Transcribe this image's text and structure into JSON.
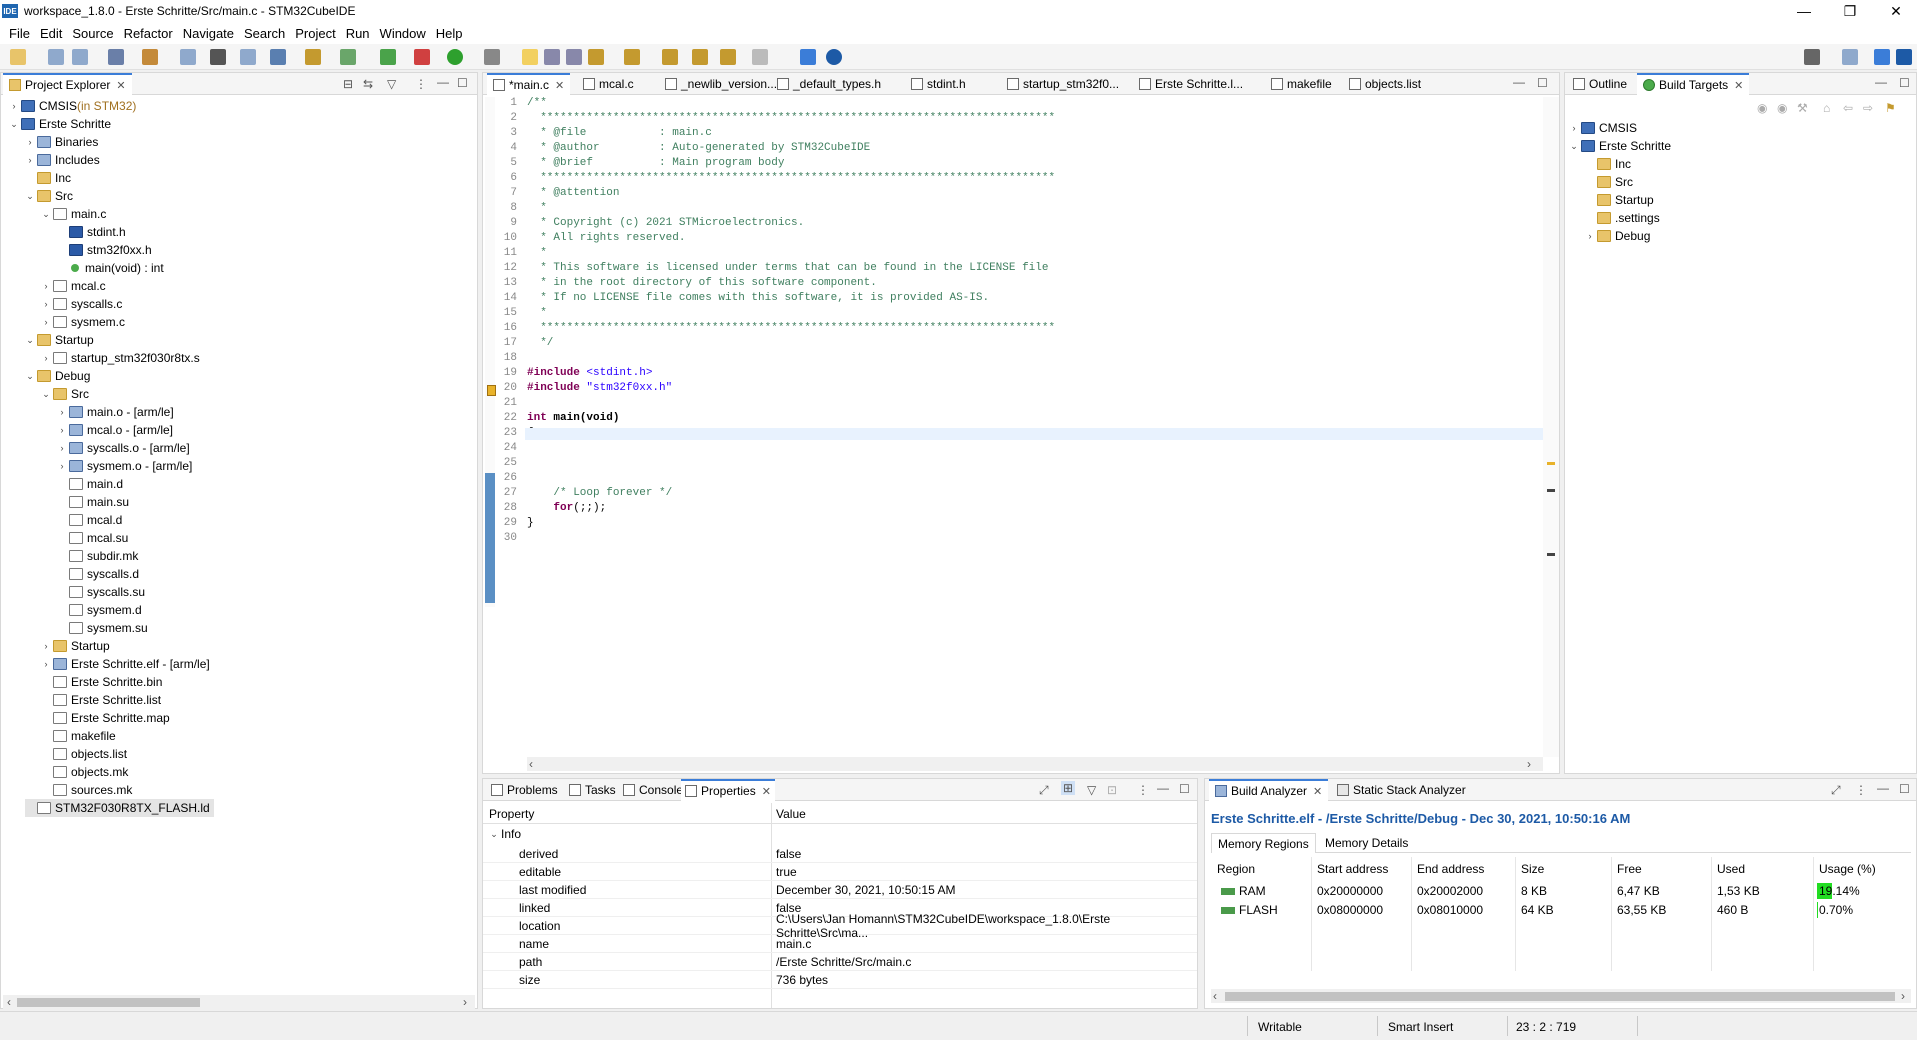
{
  "window": {
    "title": "workspace_1.8.0 - Erste Schritte/Src/main.c - STM32CubeIDE",
    "app_badge": "IDE"
  },
  "menu": [
    "File",
    "Edit",
    "Source",
    "Refactor",
    "Navigate",
    "Search",
    "Project",
    "Run",
    "Window",
    "Help"
  ],
  "project_explorer": {
    "tab_label": "Project Explorer",
    "items": [
      {
        "label": "CMSIS",
        "suffix": " (in STM32)",
        "depth": 0,
        "arrow": "›",
        "icon": "proj"
      },
      {
        "label": "Erste Schritte",
        "depth": 0,
        "arrow": "⌄",
        "icon": "proj"
      },
      {
        "label": "Binaries",
        "depth": 1,
        "arrow": "›",
        "icon": "bin"
      },
      {
        "label": "Includes",
        "depth": 1,
        "arrow": "›",
        "icon": "bin"
      },
      {
        "label": "Inc",
        "depth": 1,
        "arrow": "",
        "icon": "folder"
      },
      {
        "label": "Src",
        "depth": 1,
        "arrow": "⌄",
        "icon": "folder"
      },
      {
        "label": "main.c",
        "depth": 2,
        "arrow": "⌄",
        "icon": "file"
      },
      {
        "label": "stdint.h",
        "depth": 3,
        "arrow": "",
        "icon": "hfile"
      },
      {
        "label": "stm32f0xx.h",
        "depth": 3,
        "arrow": "",
        "icon": "hfile"
      },
      {
        "label": "main(void) : int",
        "depth": 3,
        "arrow": "",
        "icon": "green"
      },
      {
        "label": "mcal.c",
        "depth": 2,
        "arrow": "›",
        "icon": "file"
      },
      {
        "label": "syscalls.c",
        "depth": 2,
        "arrow": "›",
        "icon": "file"
      },
      {
        "label": "sysmem.c",
        "depth": 2,
        "arrow": "›",
        "icon": "file"
      },
      {
        "label": "Startup",
        "depth": 1,
        "arrow": "⌄",
        "icon": "folder"
      },
      {
        "label": "startup_stm32f030r8tx.s",
        "depth": 2,
        "arrow": "›",
        "icon": "file"
      },
      {
        "label": "Debug",
        "depth": 1,
        "arrow": "⌄",
        "icon": "folder"
      },
      {
        "label": "Src",
        "depth": 2,
        "arrow": "⌄",
        "icon": "folder"
      },
      {
        "label": "main.o - [arm/le]",
        "depth": 3,
        "arrow": "›",
        "icon": "bin"
      },
      {
        "label": "mcal.o - [arm/le]",
        "depth": 3,
        "arrow": "›",
        "icon": "bin"
      },
      {
        "label": "syscalls.o - [arm/le]",
        "depth": 3,
        "arrow": "›",
        "icon": "bin"
      },
      {
        "label": "sysmem.o - [arm/le]",
        "depth": 3,
        "arrow": "›",
        "icon": "bin"
      },
      {
        "label": "main.d",
        "depth": 3,
        "arrow": "",
        "icon": "file"
      },
      {
        "label": "main.su",
        "depth": 3,
        "arrow": "",
        "icon": "file"
      },
      {
        "label": "mcal.d",
        "depth": 3,
        "arrow": "",
        "icon": "file"
      },
      {
        "label": "mcal.su",
        "depth": 3,
        "arrow": "",
        "icon": "file"
      },
      {
        "label": "subdir.mk",
        "depth": 3,
        "arrow": "",
        "icon": "file"
      },
      {
        "label": "syscalls.d",
        "depth": 3,
        "arrow": "",
        "icon": "file"
      },
      {
        "label": "syscalls.su",
        "depth": 3,
        "arrow": "",
        "icon": "file"
      },
      {
        "label": "sysmem.d",
        "depth": 3,
        "arrow": "",
        "icon": "file"
      },
      {
        "label": "sysmem.su",
        "depth": 3,
        "arrow": "",
        "icon": "file"
      },
      {
        "label": "Startup",
        "depth": 2,
        "arrow": "›",
        "icon": "folder"
      },
      {
        "label": "Erste Schritte.elf - [arm/le]",
        "depth": 2,
        "arrow": "›",
        "icon": "bin"
      },
      {
        "label": "Erste Schritte.bin",
        "depth": 2,
        "arrow": "",
        "icon": "file"
      },
      {
        "label": "Erste Schritte.list",
        "depth": 2,
        "arrow": "",
        "icon": "file"
      },
      {
        "label": "Erste Schritte.map",
        "depth": 2,
        "arrow": "",
        "icon": "file"
      },
      {
        "label": "makefile",
        "depth": 2,
        "arrow": "",
        "icon": "file"
      },
      {
        "label": "objects.list",
        "depth": 2,
        "arrow": "",
        "icon": "file"
      },
      {
        "label": "objects.mk",
        "depth": 2,
        "arrow": "",
        "icon": "file"
      },
      {
        "label": "sources.mk",
        "depth": 2,
        "arrow": "",
        "icon": "file"
      },
      {
        "label": "STM32F030R8TX_FLASH.ld",
        "depth": 1,
        "arrow": "",
        "icon": "file",
        "selected": true
      }
    ]
  },
  "editor": {
    "tabs": [
      "*main.c",
      "mcal.c",
      "_newlib_version...",
      "_default_types.h",
      "stdint.h",
      "startup_stm32f0...",
      "Erste Schritte.l...",
      "makefile",
      "objects.list"
    ],
    "lines": [
      {
        "n": "1",
        "t": "/**",
        "c": "cmt"
      },
      {
        "n": "2",
        "t": "  ******************************************************************************",
        "c": "cmt"
      },
      {
        "n": "3",
        "t": "  * @file           : main.c",
        "c": "cmt"
      },
      {
        "n": "4",
        "t": "  * @author         : Auto-generated by STM32CubeIDE",
        "c": "cmt"
      },
      {
        "n": "5",
        "t": "  * @brief          : Main program body",
        "c": "cmt"
      },
      {
        "n": "6",
        "t": "  ******************************************************************************",
        "c": "cmt"
      },
      {
        "n": "7",
        "t": "  * @attention",
        "c": "cmt"
      },
      {
        "n": "8",
        "t": "  *",
        "c": "cmt"
      },
      {
        "n": "9",
        "t": "  * Copyright (c) 2021 STMicroelectronics.",
        "c": "cmt"
      },
      {
        "n": "10",
        "t": "  * All rights reserved.",
        "c": "cmt"
      },
      {
        "n": "11",
        "t": "  *",
        "c": "cmt"
      },
      {
        "n": "12",
        "t": "  * This software is licensed under terms that can be found in the LICENSE file",
        "c": "cmt"
      },
      {
        "n": "13",
        "t": "  * in the root directory of this software component.",
        "c": "cmt"
      },
      {
        "n": "14",
        "t": "  * If no LICENSE file comes with this software, it is provided AS-IS.",
        "c": "cmt"
      },
      {
        "n": "15",
        "t": "  *",
        "c": "cmt"
      },
      {
        "n": "16",
        "t": "  ******************************************************************************",
        "c": "cmt"
      },
      {
        "n": "17",
        "t": "  */",
        "c": "cmt"
      },
      {
        "n": "18",
        "t": "",
        "c": ""
      },
      {
        "n": "19",
        "t": "#include <stdint.h>",
        "c": "inc"
      },
      {
        "n": "20",
        "t": "#include \"stm32f0xx.h\"",
        "c": "inc"
      },
      {
        "n": "21",
        "t": "",
        "c": ""
      },
      {
        "n": "22",
        "t": "int main(void)",
        "c": "fn"
      },
      {
        "n": "23",
        "t": "{",
        "c": ""
      },
      {
        "n": "24",
        "t": "",
        "c": ""
      },
      {
        "n": "25",
        "t": "",
        "c": ""
      },
      {
        "n": "26",
        "t": "",
        "c": ""
      },
      {
        "n": "27",
        "t": "    /* Loop forever */",
        "c": "cmt"
      },
      {
        "n": "28",
        "t": "    for(;;);",
        "c": "for"
      },
      {
        "n": "29",
        "t": "}",
        "c": ""
      },
      {
        "n": "30",
        "t": "",
        "c": ""
      }
    ]
  },
  "outline": {
    "tabs": [
      "Outline",
      "Build Targets"
    ],
    "items": [
      {
        "label": "CMSIS",
        "depth": 0,
        "arrow": "›",
        "icon": "proj"
      },
      {
        "label": "Erste Schritte",
        "depth": 0,
        "arrow": "⌄",
        "icon": "proj"
      },
      {
        "label": "Inc",
        "depth": 1,
        "arrow": "",
        "icon": "folder"
      },
      {
        "label": "Src",
        "depth": 1,
        "arrow": "",
        "icon": "folder"
      },
      {
        "label": "Startup",
        "depth": 1,
        "arrow": "",
        "icon": "folder"
      },
      {
        "label": ".settings",
        "depth": 1,
        "arrow": "",
        "icon": "folder"
      },
      {
        "label": "Debug",
        "depth": 1,
        "arrow": "›",
        "icon": "folder"
      }
    ]
  },
  "bottom_left": {
    "tabs": [
      "Problems",
      "Tasks",
      "Console",
      "Properties"
    ],
    "headers": [
      "Property",
      "Value"
    ],
    "group": "Info",
    "rows": [
      [
        "derived",
        "false"
      ],
      [
        "editable",
        "true"
      ],
      [
        "last modified",
        "December 30, 2021, 10:50:15 AM"
      ],
      [
        "linked",
        "false"
      ],
      [
        "location",
        "C:\\Users\\Jan Homann\\STM32CubeIDE\\workspace_1.8.0\\Erste Schritte\\Src\\ma..."
      ],
      [
        "name",
        "main.c"
      ],
      [
        "path",
        "/Erste Schritte/Src/main.c"
      ],
      [
        "size",
        "736  bytes"
      ]
    ]
  },
  "build_analyzer": {
    "tabs": [
      "Build Analyzer",
      "Static Stack Analyzer"
    ],
    "heading": "Erste Schritte.elf - /Erste Schritte/Debug - Dec 30, 2021, 10:50:16 AM",
    "subtabs": [
      "Memory Regions",
      "Memory Details"
    ],
    "headers": [
      "Region",
      "Start address",
      "End address",
      "Size",
      "Free",
      "Used",
      "Usage (%)"
    ],
    "rows": [
      {
        "region": "RAM",
        "start": "0x20000000",
        "end": "0x20002000",
        "size": "8 KB",
        "free": "6,47 KB",
        "used": "1,53 KB",
        "usage": "19.14%",
        "usage_fraction": 0.1914
      },
      {
        "region": "FLASH",
        "start": "0x08000000",
        "end": "0x08010000",
        "size": "64 KB",
        "free": "63,55 KB",
        "used": "460 B",
        "usage": "0.70%",
        "usage_fraction": 0.007
      }
    ],
    "bar_color": "#22dd22"
  },
  "statusbar": {
    "mode": "Writable",
    "insert": "Smart Insert",
    "position": "23 : 2 : 719"
  },
  "colors": {
    "accent": "#3b7dd8",
    "comment": "#3f7f5f",
    "keyword": "#7f0055",
    "string": "#2a00ff"
  }
}
